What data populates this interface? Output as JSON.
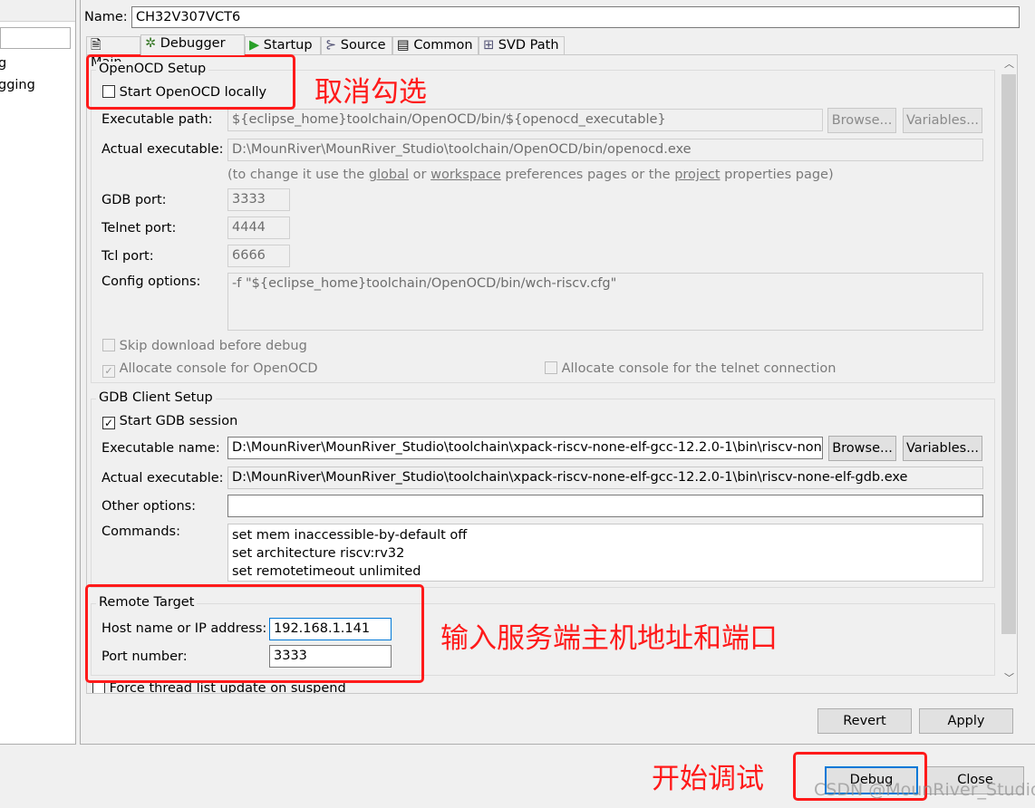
{
  "sidebar": {
    "items": [
      "g",
      "gging"
    ]
  },
  "name": {
    "label": "Name:",
    "value": "CH32V307VCT6"
  },
  "tabs": [
    {
      "label": "Main",
      "icon": "document-icon"
    },
    {
      "label": "Debugger",
      "icon": "bug-icon"
    },
    {
      "label": "Startup",
      "icon": "play-icon"
    },
    {
      "label": "Source",
      "icon": "source-icon"
    },
    {
      "label": "Common",
      "icon": "table-icon"
    },
    {
      "label": "SVD Path",
      "icon": "tree-icon"
    }
  ],
  "openocd": {
    "title": "OpenOCD Setup",
    "start_locally": "Start OpenOCD locally",
    "start_checked": false,
    "exec_path_label": "Executable path:",
    "exec_path": "${eclipse_home}toolchain/OpenOCD/bin/${openocd_executable}",
    "browse": "Browse...",
    "variables": "Variables...",
    "actual_label": "Actual executable:",
    "actual": "D:\\MounRiver\\MounRiver_Studio\\toolchain/OpenOCD/bin/openocd.exe",
    "note_pre": "(to change it use the ",
    "note_global": "global",
    "note_or": " or ",
    "note_workspace": "workspace",
    "note_mid": " preferences pages or the ",
    "note_project": "project",
    "note_post": " properties page)",
    "gdb_port_label": "GDB port:",
    "gdb_port": "3333",
    "telnet_label": "Telnet port:",
    "telnet": "4444",
    "tcl_label": "Tcl port:",
    "tcl": "6666",
    "config_label": "Config options:",
    "config": "-f \"${eclipse_home}toolchain/OpenOCD/bin/wch-riscv.cfg\"",
    "skip_download": "Skip download before debug",
    "allocate_console": "Allocate console for OpenOCD",
    "allocate_telnet": "Allocate console for the telnet connection"
  },
  "gdb": {
    "title": "GDB Client Setup",
    "start_session": "Start GDB session",
    "start_checked": true,
    "exec_label": "Executable name:",
    "exec": "D:\\MounRiver\\MounRiver_Studio\\toolchain\\xpack-riscv-none-elf-gcc-12.2.0-1\\bin\\riscv-none-elf-gdb.exe",
    "browse": "Browse...",
    "variables": "Variables...",
    "actual_label": "Actual executable:",
    "actual": "D:\\MounRiver\\MounRiver_Studio\\toolchain\\xpack-riscv-none-elf-gcc-12.2.0-1\\bin\\riscv-none-elf-gdb.exe",
    "other_label": "Other options:",
    "other": "",
    "commands_label": "Commands:",
    "commands": [
      "set mem inaccessible-by-default off",
      "set architecture riscv:rv32",
      "set remotetimeout unlimited"
    ]
  },
  "remote": {
    "title": "Remote Target",
    "host_label": "Host name or IP address:",
    "host": "192.168.1.141",
    "port_label": "Port number:",
    "port": "3333"
  },
  "force_thread": "Force thread list update on suspend",
  "buttons": {
    "revert": "Revert",
    "apply": "Apply",
    "debug": "Debug",
    "close": "Close"
  },
  "annotations": {
    "uncheck": "取消勾选",
    "enter_server": "输入服务端主机地址和端口",
    "start_debug": "开始调试",
    "color": "#ff1a1a"
  },
  "watermark": "CSDN @MounRiver_Studio"
}
